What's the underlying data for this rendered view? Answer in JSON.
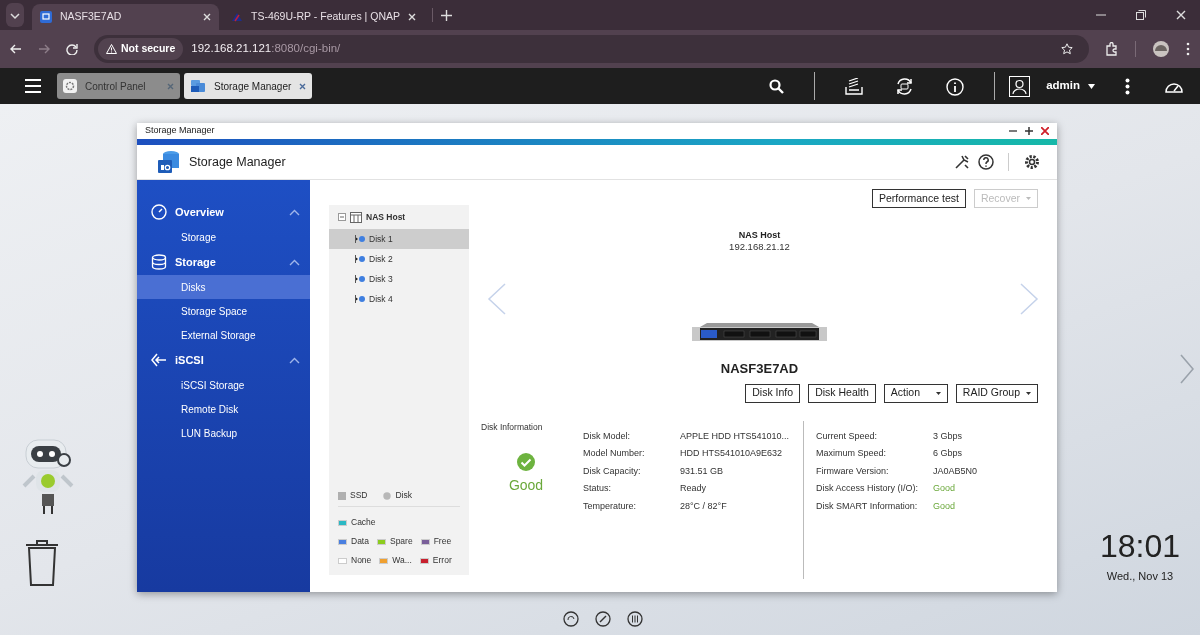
{
  "browser": {
    "tabs": [
      {
        "title": "NASF3E7AD",
        "selected": true
      },
      {
        "title": "TS-469U-RP - Features | QNAP",
        "selected": false
      }
    ],
    "address": {
      "security": "Not secure",
      "host": "192.168.21.121",
      "path": ":8080/cgi-bin/"
    }
  },
  "qts_bar": {
    "app_tabs": [
      {
        "label": "Control Panel",
        "selected": false
      },
      {
        "label": "Storage Manager",
        "selected": true
      }
    ],
    "user": "admin"
  },
  "window": {
    "title": "Storage Manager",
    "header_title": "Storage Manager"
  },
  "sidebar": {
    "sections": [
      {
        "label": "Overview",
        "kind": "overview",
        "expanded": true,
        "items": [
          {
            "label": "Storage",
            "selected": false
          }
        ]
      },
      {
        "label": "Storage",
        "kind": "storage",
        "expanded": true,
        "items": [
          {
            "label": "Disks",
            "selected": true
          },
          {
            "label": "Storage Space",
            "selected": false
          },
          {
            "label": "External Storage",
            "selected": false
          }
        ]
      },
      {
        "label": "iSCSI",
        "kind": "iscsi",
        "expanded": true,
        "items": [
          {
            "label": "iSCSI Storage",
            "selected": false
          },
          {
            "label": "Remote Disk",
            "selected": false
          },
          {
            "label": "LUN Backup",
            "selected": false
          }
        ]
      }
    ]
  },
  "tree": {
    "root": "NAS Host",
    "expanded": true,
    "children": [
      {
        "label": "Disk 1",
        "selected": true
      },
      {
        "label": "Disk 2",
        "selected": false
      },
      {
        "label": "Disk 3",
        "selected": false
      },
      {
        "label": "Disk 4",
        "selected": false
      }
    ]
  },
  "legend": {
    "types": [
      {
        "label": "SSD",
        "kind": "square"
      },
      {
        "label": "Disk",
        "kind": "circle"
      }
    ],
    "statuses": [
      [
        {
          "label": "Cache",
          "color": "#2bb8c4"
        }
      ],
      [
        {
          "label": "Data",
          "color": "#4a7fe0"
        },
        {
          "label": "Spare",
          "color": "#8ccc1e"
        },
        {
          "label": "Free",
          "color": "#7a5f9a"
        }
      ],
      [
        {
          "label": "None",
          "color": "#ffffff"
        },
        {
          "label": "Wa...",
          "color": "#f0a030"
        },
        {
          "label": "Error",
          "color": "#c8202e"
        }
      ]
    ]
  },
  "toolbar": [
    {
      "label": "Performance test",
      "kind": "button",
      "disabled": false
    },
    {
      "label": "Recover",
      "kind": "dropdown",
      "disabled": true
    }
  ],
  "host": {
    "name": "NAS Host",
    "ip": "192.168.21.12",
    "device": "NASF3E7AD"
  },
  "disk_buttons": [
    {
      "label": "Disk Info",
      "kind": "button"
    },
    {
      "label": "Disk Health",
      "kind": "button"
    },
    {
      "label": "Action",
      "kind": "dropdown"
    },
    {
      "label": "RAID Group",
      "kind": "dropdown"
    }
  ],
  "disk_info": {
    "title": "Disk Information",
    "status": "Good",
    "left": [
      {
        "label": "Disk Model:",
        "value": "APPLE HDD HTS541010...",
        "kind": "text"
      },
      {
        "label": "Model Number:",
        "value": "HDD HTS541010A9E632",
        "kind": "text"
      },
      {
        "label": "Disk Capacity:",
        "value": "931.51 GB",
        "kind": "text"
      },
      {
        "label": "Status:",
        "value": "Ready",
        "kind": "text"
      },
      {
        "label": "Temperature:",
        "value": "28°C / 82°F",
        "kind": "text"
      }
    ],
    "right": [
      {
        "label": "Current Speed:",
        "value": "3 Gbps",
        "kind": "text"
      },
      {
        "label": "Maximum Speed:",
        "value": "6 Gbps",
        "kind": "text"
      },
      {
        "label": "Firmware Version:",
        "value": "JA0AB5N0",
        "kind": "text"
      },
      {
        "label": "Disk Access History (I/O):",
        "value": "Good",
        "kind": "health"
      },
      {
        "label": "Disk SMART Information:",
        "value": "Good",
        "kind": "health"
      }
    ]
  },
  "desktop": {
    "clock": "18:01",
    "date": "Wed., Nov 13"
  }
}
